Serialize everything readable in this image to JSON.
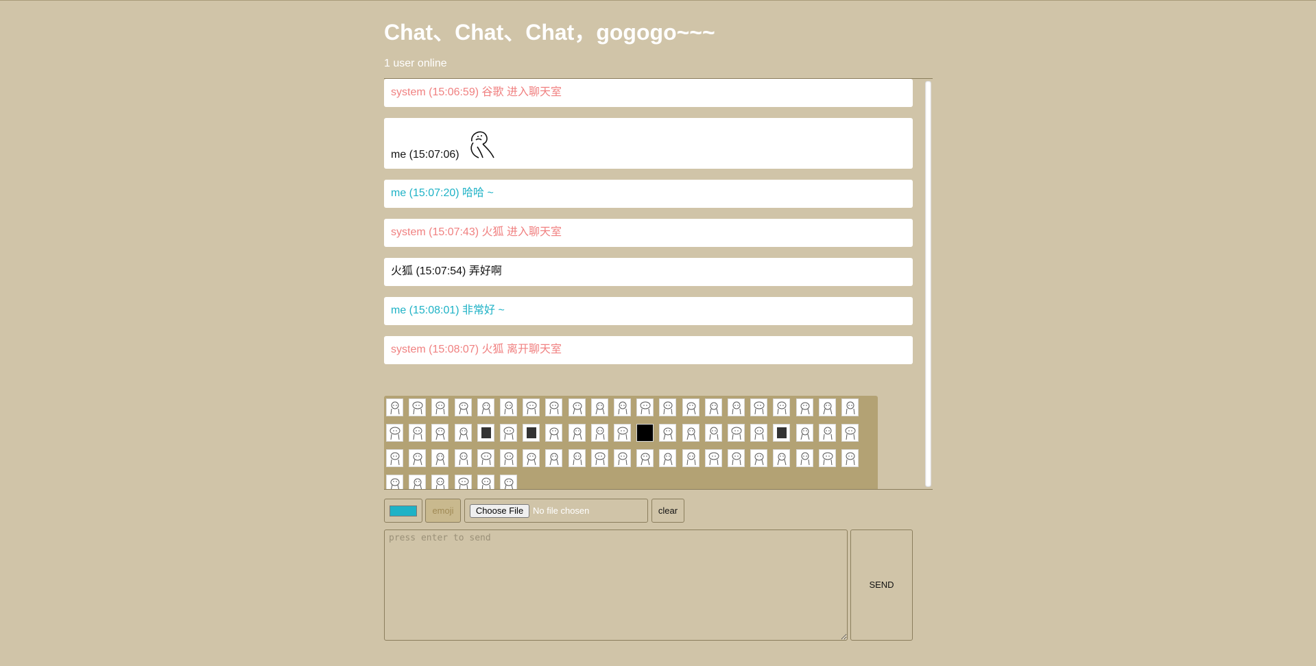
{
  "header": {
    "title": "Chat、Chat、Chat，gogogo~~~",
    "online_status": "1 user online"
  },
  "messages": [
    {
      "type": "system",
      "text": "system (15:06:59) 谷歌 进入聊天室"
    },
    {
      "type": "me",
      "text": "me (15:07:06)",
      "has_sticker": true
    },
    {
      "type": "me",
      "text": "me (15:07:20) 哈哈 ~"
    },
    {
      "type": "system",
      "text": "system (15:07:43) 火狐 进入聊天室"
    },
    {
      "type": "other",
      "text": "火狐 (15:07:54) 弄好啊"
    },
    {
      "type": "me",
      "text": "me (15:08:01) 非常好 ~"
    },
    {
      "type": "system",
      "text": "system (15:08:07) 火狐 离开聊天室"
    }
  ],
  "emoji_panel": {
    "rows": [
      21,
      21,
      21,
      6
    ]
  },
  "toolbar": {
    "color_value": "#1eb2c6",
    "emoji_label": "emoji",
    "file_button_label": "Choose File",
    "file_status": "No file chosen",
    "clear_label": "clear"
  },
  "composer": {
    "placeholder": "press enter to send",
    "send_label": "SEND"
  },
  "colors": {
    "background": "#d0c4a8",
    "panel": "#b3a274",
    "system_text": "#f08080",
    "me_text": "#1eb2c6",
    "other_text": "#111111"
  }
}
